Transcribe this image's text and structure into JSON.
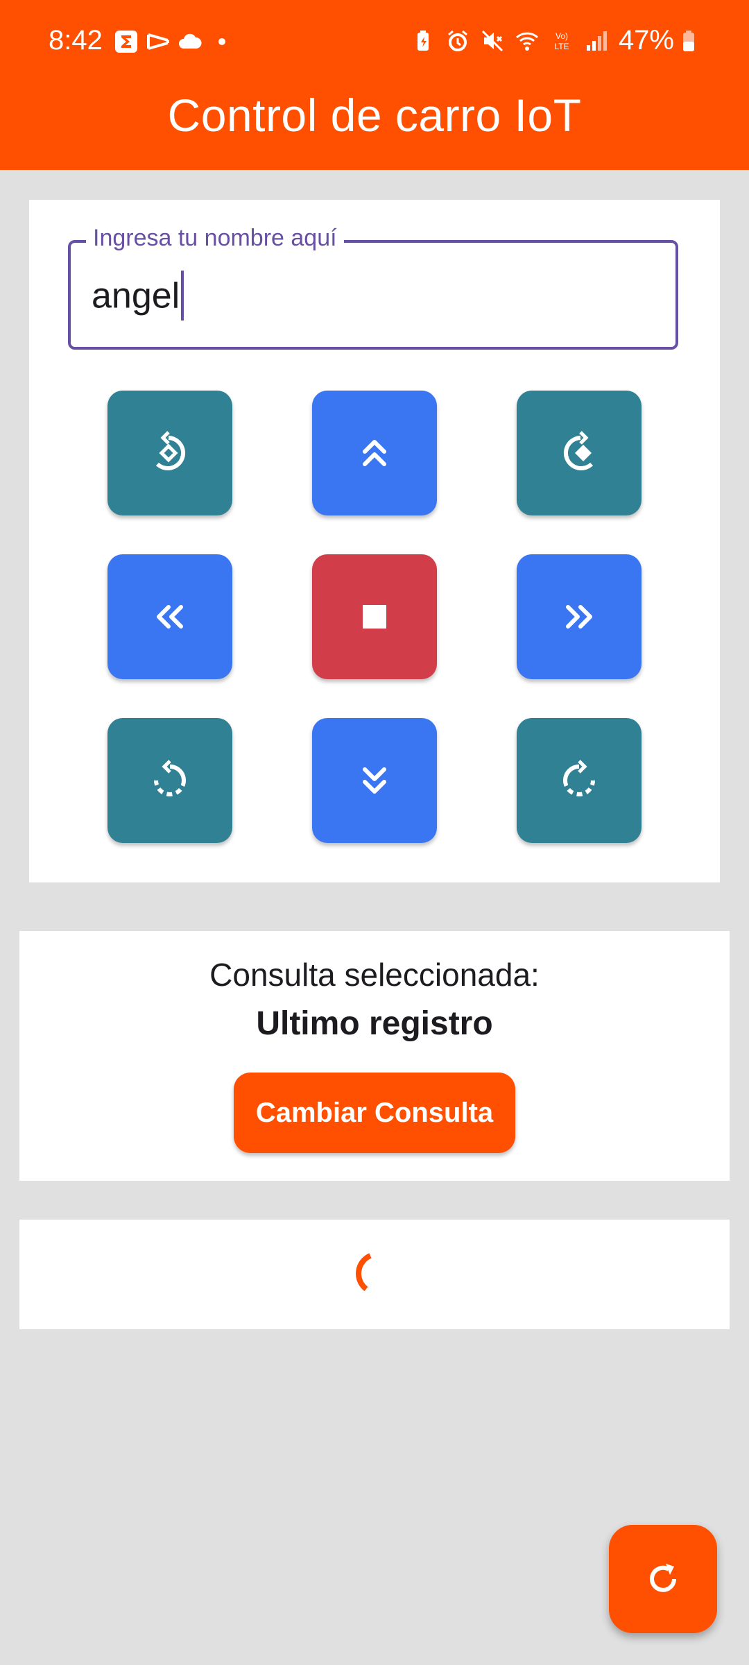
{
  "status_bar": {
    "time": "8:42",
    "battery_percent": "47%",
    "icons_left": [
      "sigma-app-icon",
      "capcut-icon",
      "cloud-icon",
      "dot-icon"
    ],
    "icons_right": [
      "battery-saver-icon",
      "alarm-icon",
      "mute-icon",
      "wifi-icon",
      "volte-icon",
      "signal-icon",
      "battery-icon"
    ]
  },
  "app_bar": {
    "title": "Control de carro IoT"
  },
  "name_field": {
    "label": "Ingresa tu nombre aquí",
    "value": "angel"
  },
  "controls": [
    {
      "name": "rotate-left-button",
      "icon": "rotate-left-diamond-icon",
      "color": "#2f8193"
    },
    {
      "name": "forward-button",
      "icon": "double-chevron-up-icon",
      "color": "#3b76f2"
    },
    {
      "name": "rotate-right-button",
      "icon": "rotate-right-diamond-icon",
      "color": "#2f8193"
    },
    {
      "name": "left-button",
      "icon": "double-chevron-left-icon",
      "color": "#3b76f2"
    },
    {
      "name": "stop-button",
      "icon": "stop-icon",
      "color": "#d13d48"
    },
    {
      "name": "right-button",
      "icon": "double-chevron-right-icon",
      "color": "#3b76f2"
    },
    {
      "name": "turn-left-button",
      "icon": "rotate-ccw-dashed-icon",
      "color": "#2f8193"
    },
    {
      "name": "backward-button",
      "icon": "double-chevron-down-icon",
      "color": "#3b76f2"
    },
    {
      "name": "turn-right-button",
      "icon": "rotate-cw-dashed-icon",
      "color": "#2f8193"
    }
  ],
  "query": {
    "label": "Consulta seleccionada:",
    "value": "Ultimo registro",
    "button_label": "Cambiar Consulta"
  },
  "loading": {
    "icon": "progress-spinner-icon",
    "color": "#ff4f00"
  },
  "fab": {
    "icon": "refresh-icon"
  },
  "colors": {
    "accent": "#ff4f00",
    "teal": "#2f8193",
    "blue": "#3b76f2",
    "red": "#d13d48",
    "field_border": "#6750a4",
    "background": "#e0e0e0"
  }
}
